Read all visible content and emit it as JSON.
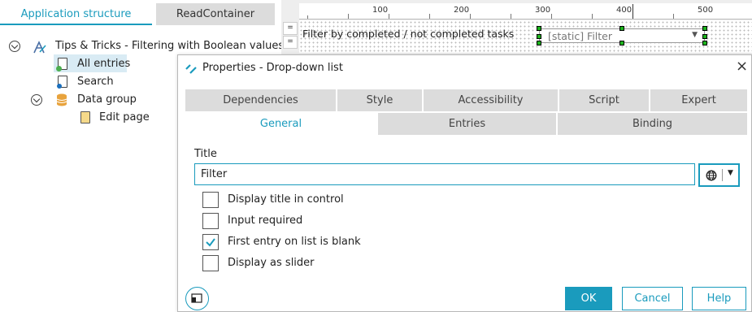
{
  "left_panel": {
    "tabs": [
      {
        "label": "Application structure"
      },
      {
        "label": "ReadContainer"
      }
    ],
    "tree": {
      "app": {
        "label": "Tips & Tricks - Filtering with Boolean values"
      },
      "items": [
        {
          "label": "All entries",
          "icon": "form-icon"
        },
        {
          "label": "Search",
          "icon": "search-form-icon"
        },
        {
          "label": "Data group",
          "icon": "database-icon"
        },
        {
          "label": "Edit page",
          "icon": "page-icon"
        }
      ]
    }
  },
  "designer": {
    "ruler_labels": [
      "100",
      "200",
      "300",
      "400",
      "500"
    ],
    "row_label": "Filter by completed / not completed tasks",
    "dropdown_text": "[static] Filter",
    "handle_symbol": "="
  },
  "dialog": {
    "title": "Properties - Drop-down list",
    "tabs_row1": [
      "Dependencies",
      "Style",
      "Accessibility",
      "Script",
      "Expert"
    ],
    "tabs_row2": [
      "General",
      "Entries",
      "Binding"
    ],
    "active_tab": "General",
    "title_field": {
      "label": "Title",
      "value": "Filter"
    },
    "checkboxes": [
      {
        "label": "Display title in control",
        "checked": false
      },
      {
        "label": "Input required",
        "checked": false
      },
      {
        "label": "First entry on list is blank",
        "checked": true
      },
      {
        "label": "Display as slider",
        "checked": false
      }
    ],
    "buttons": {
      "ok": "OK",
      "cancel": "Cancel",
      "help": "Help"
    }
  },
  "colors": {
    "accent": "#1a9bbd",
    "selection": "#d9ebf4",
    "handles": "#1db31d"
  }
}
